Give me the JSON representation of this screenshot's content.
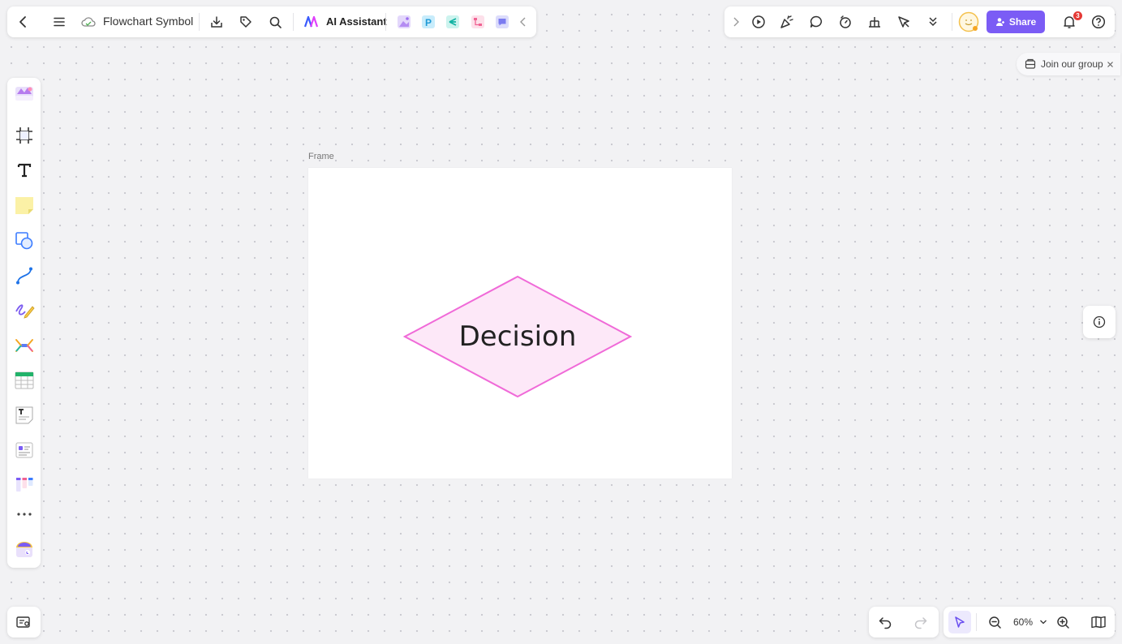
{
  "app": {
    "doc_title": "Flowchart Symbol",
    "ai_label": "AI Assistant",
    "share_label": "Share",
    "notification_count": "3",
    "join_group_label": "Join our group",
    "frame_label": "Frame",
    "shape_text": "Decision",
    "zoom_level": "60%"
  },
  "colors": {
    "accent": "#7b5cf5",
    "diamond_fill": "#fde8f8",
    "diamond_stroke": "#f06ad8",
    "badge": "#e53935"
  },
  "icons": {
    "top_left": [
      "back-icon",
      "menu-icon",
      "cloud-sync-icon",
      "download-icon",
      "tag-icon",
      "search-icon",
      "ai-logo-icon",
      "image-gen-icon",
      "ppt-icon",
      "mindmap-icon",
      "flowchart-icon",
      "chat-icon",
      "collapse-left-icon"
    ],
    "top_right": [
      "expand-right-icon",
      "present-icon",
      "celebrate-icon",
      "comment-icon",
      "timer-icon",
      "vote-icon",
      "laser-icon",
      "more-down-icon",
      "avatar",
      "bell-icon",
      "help-icon"
    ],
    "left_tools": [
      "templates-icon",
      "frame-tool-icon",
      "text-tool-icon",
      "sticky-note-icon",
      "shape-tool-icon",
      "connector-icon",
      "pen-icon",
      "mindmap-tool-icon",
      "table-icon",
      "text-doc-icon",
      "card-icon",
      "kanban-icon",
      "more-tools-icon",
      "plugin-icon"
    ]
  }
}
